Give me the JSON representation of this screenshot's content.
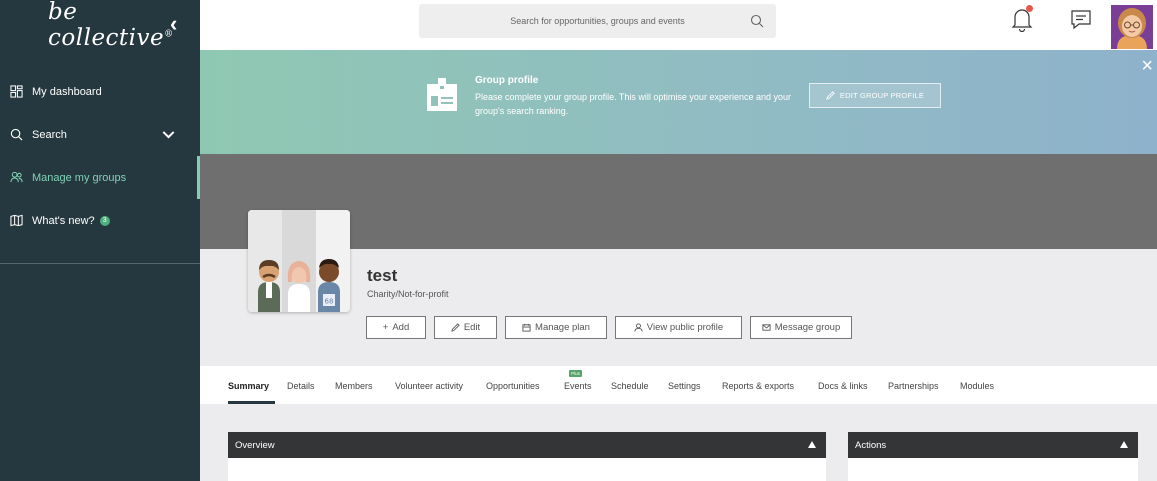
{
  "app": {
    "logo_text": "be collective",
    "logo_reg": "®",
    "collapse_glyph": "‹"
  },
  "sidebar": {
    "items": [
      {
        "label": "My dashboard",
        "icon": "dashboard-icon"
      },
      {
        "label": "Search",
        "icon": "search-icon"
      },
      {
        "label": "Manage my groups",
        "icon": "groups-icon",
        "active": true
      },
      {
        "label": "What's new?",
        "icon": "book-icon",
        "badge": "3"
      }
    ]
  },
  "topbar": {
    "search_placeholder": "Search for opportunities, groups and events"
  },
  "banner": {
    "title": "Group profile",
    "text": "Please complete your group profile. This will optimise your experience and your group's search ranking.",
    "button_label": "EDIT GROUP PROFILE",
    "close_glyph": "×"
  },
  "group": {
    "name": "test",
    "type": "Charity/Not-for-profit"
  },
  "actions": [
    {
      "label": "Add",
      "icon": "plus-icon"
    },
    {
      "label": "Edit",
      "icon": "pencil-icon"
    },
    {
      "label": "Manage plan",
      "icon": "calendar-icon"
    },
    {
      "label": "View public profile",
      "icon": "user-icon"
    },
    {
      "label": "Message group",
      "icon": "envelope-icon"
    }
  ],
  "tabs": [
    {
      "label": "Summary",
      "active": true
    },
    {
      "label": "Details"
    },
    {
      "label": "Members"
    },
    {
      "label": "Volunteer activity"
    },
    {
      "label": "Opportunities"
    },
    {
      "label": "Events",
      "badge": "Plus"
    },
    {
      "label": "Schedule"
    },
    {
      "label": "Settings"
    },
    {
      "label": "Reports & exports"
    },
    {
      "label": "Docs & links"
    },
    {
      "label": "Partnerships"
    },
    {
      "label": "Modules"
    }
  ],
  "panels": {
    "overview_title": "Overview",
    "actions_title": "Actions"
  },
  "colors": {
    "sidebar_bg": "#26383f",
    "accent": "#7fd1b6",
    "panel_head": "#333537",
    "notification_dot": "#e8584a"
  }
}
